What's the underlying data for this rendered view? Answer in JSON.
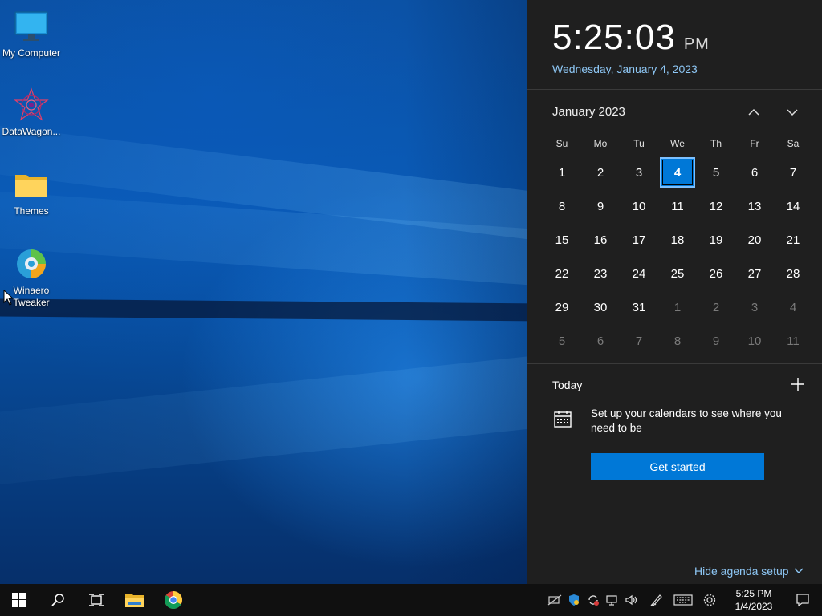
{
  "desktop": {
    "icons": [
      {
        "label": "My Computer",
        "icon": "monitor-icon"
      },
      {
        "label": "DataWagon...",
        "icon": "datawagon-icon"
      },
      {
        "label": "Themes",
        "icon": "folder-icon"
      },
      {
        "label": "Winaero Tweaker",
        "icon": "winaero-icon"
      }
    ]
  },
  "flyout": {
    "time": "5:25:03",
    "ampm": "PM",
    "long_date": "Wednesday, January 4, 2023",
    "month_label": "January 2023",
    "nav_up_icon": "chevron-up-icon",
    "nav_down_icon": "chevron-down-icon",
    "weekdays": [
      "Su",
      "Mo",
      "Tu",
      "We",
      "Th",
      "Fr",
      "Sa"
    ],
    "weeks": [
      [
        {
          "d": "1"
        },
        {
          "d": "2"
        },
        {
          "d": "3"
        },
        {
          "d": "4",
          "today": true
        },
        {
          "d": "5"
        },
        {
          "d": "6"
        },
        {
          "d": "7"
        }
      ],
      [
        {
          "d": "8"
        },
        {
          "d": "9"
        },
        {
          "d": "10"
        },
        {
          "d": "11"
        },
        {
          "d": "12"
        },
        {
          "d": "13"
        },
        {
          "d": "14"
        }
      ],
      [
        {
          "d": "15"
        },
        {
          "d": "16"
        },
        {
          "d": "17"
        },
        {
          "d": "18"
        },
        {
          "d": "19"
        },
        {
          "d": "20"
        },
        {
          "d": "21"
        }
      ],
      [
        {
          "d": "22"
        },
        {
          "d": "23"
        },
        {
          "d": "24"
        },
        {
          "d": "25"
        },
        {
          "d": "26"
        },
        {
          "d": "27"
        },
        {
          "d": "28"
        }
      ],
      [
        {
          "d": "29"
        },
        {
          "d": "30"
        },
        {
          "d": "31"
        },
        {
          "d": "1",
          "other": true
        },
        {
          "d": "2",
          "other": true
        },
        {
          "d": "3",
          "other": true
        },
        {
          "d": "4",
          "other": true
        }
      ],
      [
        {
          "d": "5",
          "other": true
        },
        {
          "d": "6",
          "other": true
        },
        {
          "d": "7",
          "other": true
        },
        {
          "d": "8",
          "other": true
        },
        {
          "d": "9",
          "other": true
        },
        {
          "d": "10",
          "other": true
        },
        {
          "d": "11",
          "other": true
        }
      ]
    ],
    "agenda": {
      "today_label": "Today",
      "setup_text": "Set up your calendars to see where you need to be",
      "get_started": "Get started",
      "hide_agenda": "Hide agenda setup"
    }
  },
  "taskbar": {
    "buttons": [
      "start-icon",
      "search-icon",
      "task-view-icon",
      "file-explorer-icon",
      "chrome-icon"
    ],
    "tray_icons": [
      "network-disconnected-icon",
      "defender-icon",
      "sync-icon",
      "projector-icon",
      "volume-icon",
      "pen-icon",
      "keyboard-icon",
      "settings-gear-icon"
    ],
    "clock_time": "5:25 PM",
    "clock_date": "1/4/2023",
    "notification_icon": "notification-icon"
  },
  "colors": {
    "accent": "#0078d7",
    "link": "#8ec7f5",
    "flyout_bg": "#1f1f1f",
    "taskbar_bg": "#101010"
  }
}
